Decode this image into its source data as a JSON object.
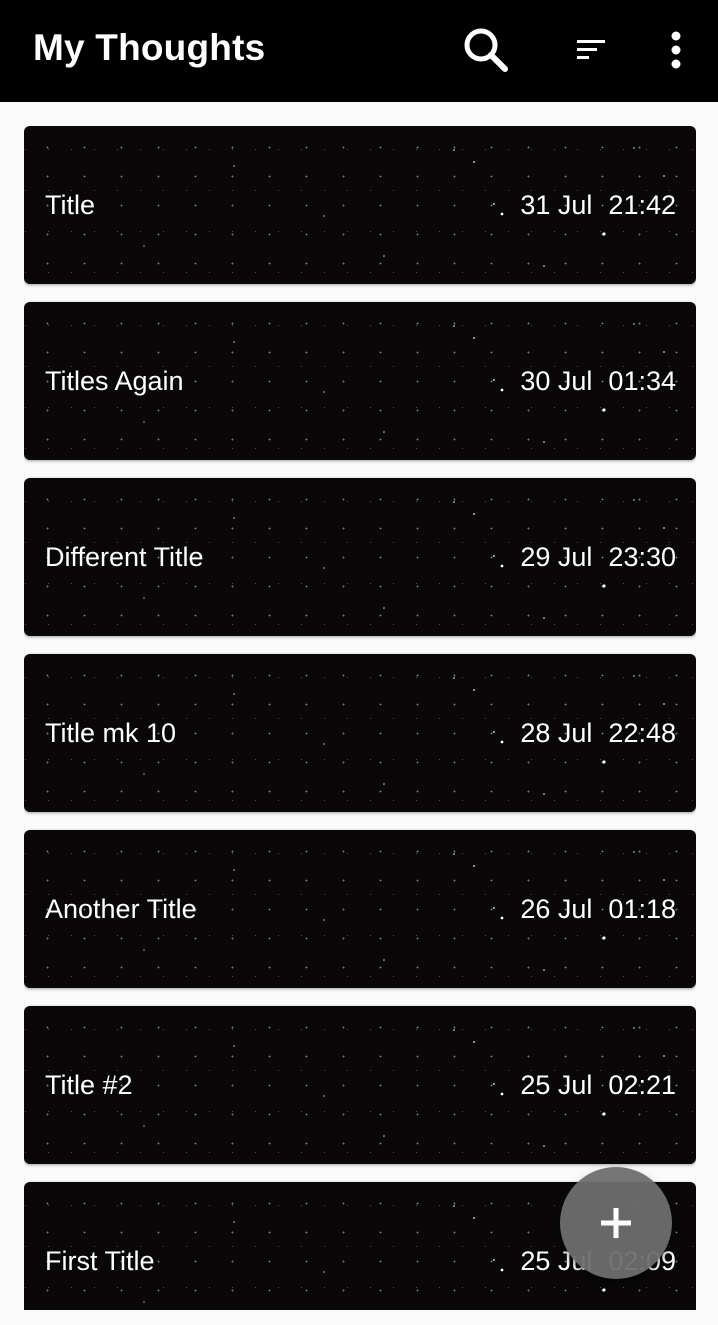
{
  "appbar": {
    "title": "My Thoughts",
    "actions": [
      {
        "name": "search",
        "icon": "search-icon"
      },
      {
        "name": "sort",
        "icon": "sort-icon"
      },
      {
        "name": "more",
        "icon": "more-vert-icon"
      }
    ]
  },
  "notes": [
    {
      "title": "Title",
      "date": "31 Jul",
      "time": "21:42"
    },
    {
      "title": "Titles Again",
      "date": "30 Jul",
      "time": "01:34"
    },
    {
      "title": "Different Title",
      "date": "29 Jul",
      "time": "23:30"
    },
    {
      "title": "Title mk 10",
      "date": "28 Jul",
      "time": "22:48"
    },
    {
      "title": "Another Title",
      "date": "26 Jul",
      "time": "01:18"
    },
    {
      "title": "Title #2",
      "date": "25 Jul",
      "time": "02:21"
    },
    {
      "title": "First Title",
      "date": "25 Jul",
      "time": "02:09"
    }
  ],
  "fab": {
    "icon": "plus-icon"
  },
  "colors": {
    "appbar_bg": "#000000",
    "page_bg": "#fafafa",
    "card_bg": "#090707",
    "text": "#ffffff",
    "fab_bg": "#6e6e6e"
  }
}
